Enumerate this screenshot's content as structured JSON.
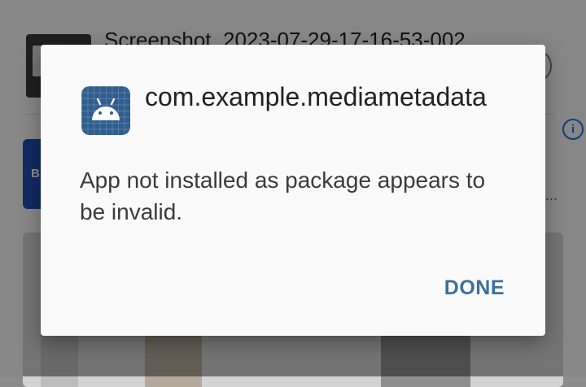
{
  "background": {
    "file_title": "Screenshot_2023-07-29-17-16-53-002",
    "card_label": "B",
    "ellipsis": "...",
    "info_icon": "info-icon",
    "info_glyph": "i"
  },
  "dialog": {
    "icon": "android-app-icon",
    "title": "com.example.mediametadata",
    "message": "App not installed as package appears to be invalid.",
    "done_label": "DONE"
  },
  "colors": {
    "accent": "#3d6f9c",
    "app_icon_bg": "#2f5e8f",
    "dialog_bg": "#fafafa"
  }
}
